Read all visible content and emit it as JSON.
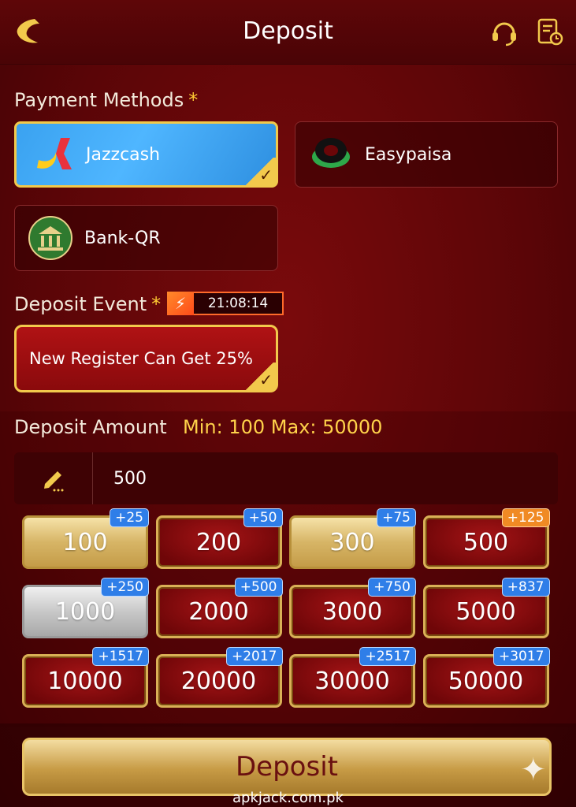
{
  "header": {
    "title": "Deposit"
  },
  "payment": {
    "label": "Payment Methods",
    "required_mark": "*",
    "methods": [
      {
        "label": "Jazzcash",
        "selected": true
      },
      {
        "label": "Easypaisa",
        "selected": false
      },
      {
        "label": "Bank-QR",
        "selected": false
      }
    ]
  },
  "event": {
    "label": "Deposit Event",
    "required_mark": "*",
    "timer": "21:08:14",
    "offer": "New Register Can Get 25%"
  },
  "amount": {
    "label": "Deposit Amount",
    "minmax": "Min: 100  Max: 50000",
    "value": "500",
    "chips": [
      {
        "value": "100",
        "bonus": "+25",
        "style": "gold"
      },
      {
        "value": "200",
        "bonus": "+50",
        "style": "red"
      },
      {
        "value": "300",
        "bonus": "+75",
        "style": "gold"
      },
      {
        "value": "500",
        "bonus": "+125",
        "style": "red",
        "bonus_color": "orange"
      },
      {
        "value": "1000",
        "bonus": "+250",
        "style": "silver"
      },
      {
        "value": "2000",
        "bonus": "+500",
        "style": "red"
      },
      {
        "value": "3000",
        "bonus": "+750",
        "style": "red"
      },
      {
        "value": "5000",
        "bonus": "+837",
        "style": "red"
      },
      {
        "value": "10000",
        "bonus": "+1517",
        "style": "red"
      },
      {
        "value": "20000",
        "bonus": "+2017",
        "style": "red"
      },
      {
        "value": "30000",
        "bonus": "+2517",
        "style": "red"
      },
      {
        "value": "50000",
        "bonus": "+3017",
        "style": "red"
      }
    ]
  },
  "footer": {
    "deposit_label": "Deposit",
    "watermark": "apkjack.com.pk"
  },
  "icons": {
    "back": "back-icon",
    "support": "headset-icon",
    "records": "records-icon",
    "edit": "pencil-icon",
    "check": "checkmark-icon",
    "bolt": "lightning-icon",
    "sparkle": "sparkle-icon"
  },
  "colors": {
    "accent_gold": "#f2c94c",
    "bonus_blue": "#2f7ee8",
    "bonus_orange": "#f08a24",
    "bg_red": "#6a0608"
  }
}
